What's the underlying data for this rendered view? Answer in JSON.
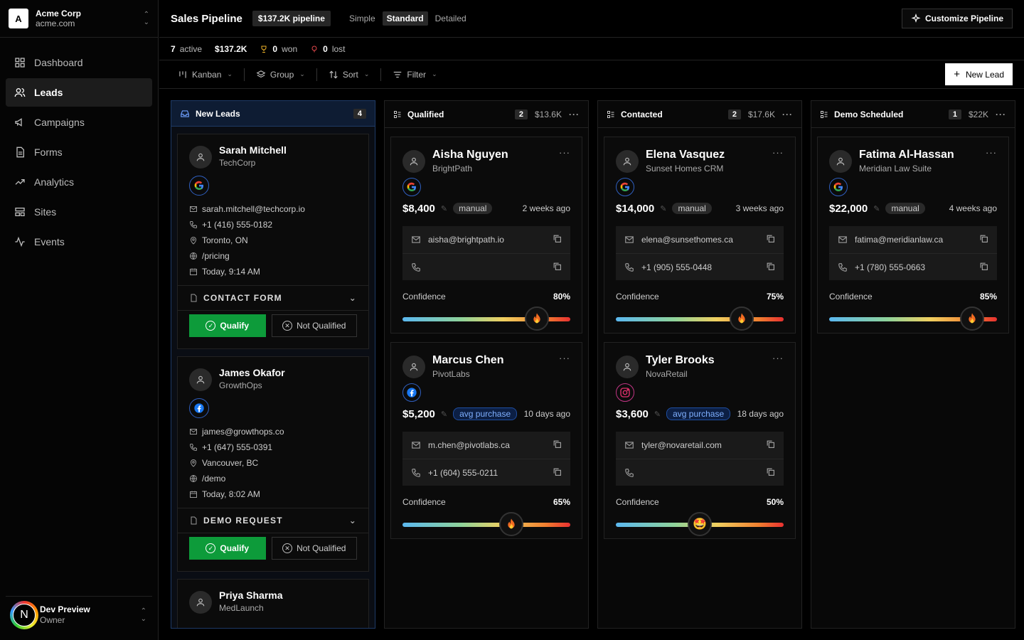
{
  "workspace": {
    "logo": "A",
    "name": "Acme Corp",
    "domain": "acme.com"
  },
  "nav": [
    {
      "label": "Dashboard",
      "icon": "dashboard-icon"
    },
    {
      "label": "Leads",
      "icon": "users-icon"
    },
    {
      "label": "Campaigns",
      "icon": "megaphone-icon"
    },
    {
      "label": "Forms",
      "icon": "document-icon"
    },
    {
      "label": "Analytics",
      "icon": "trending-up-icon"
    },
    {
      "label": "Sites",
      "icon": "layout-icon"
    },
    {
      "label": "Events",
      "icon": "activity-icon"
    }
  ],
  "active_nav": "Leads",
  "user": {
    "initial": "N",
    "name": "Dev Preview",
    "role": "Owner"
  },
  "header": {
    "title": "Sales Pipeline",
    "pipeline_value": "$137.2K pipeline",
    "views": [
      "Simple",
      "Standard",
      "Detailed"
    ],
    "active_view": "Standard",
    "customize_label": "Customize Pipeline"
  },
  "stats": {
    "active_count": "7",
    "active_label": "active",
    "total": "$137.2K",
    "won_count": "0",
    "won_label": "won",
    "lost_count": "0",
    "lost_label": "lost"
  },
  "toolbar": {
    "kanban": "Kanban",
    "group": "Group",
    "sort": "Sort",
    "filter": "Filter",
    "new_lead": "New Lead"
  },
  "new_leads": {
    "title": "New Leads",
    "count": "4",
    "cards": [
      {
        "name": "Sarah Mitchell",
        "company": "TechCorp",
        "source": "google",
        "email": "sarah.mitchell@techcorp.io",
        "phone": "+1 (416) 555-0182",
        "location": "Toronto, ON",
        "page": "/pricing",
        "time": "Today, 9:14 AM",
        "form": "CONTACT FORM"
      },
      {
        "name": "James Okafor",
        "company": "GrowthOps",
        "source": "facebook",
        "email": "james@growthops.co",
        "phone": "+1 (647) 555-0391",
        "location": "Vancouver, BC",
        "page": "/demo",
        "time": "Today, 8:02 AM",
        "form": "DEMO REQUEST"
      },
      {
        "name": "Priya Sharma",
        "company": "MedLaunch"
      }
    ],
    "qualify_label": "Qualify",
    "not_qualified_label": "Not Qualified"
  },
  "columns": [
    {
      "title": "Qualified",
      "count": "2",
      "value": "$13.6K",
      "cards": [
        {
          "name": "Aisha Nguyen",
          "company": "BrightPath",
          "source": "google",
          "value": "$8,400",
          "tag": "manual",
          "ago": "2 weeks ago",
          "email": "aisha@brightpath.io",
          "phone": "",
          "confidence": 80,
          "confidence_label": "80%"
        },
        {
          "name": "Marcus Chen",
          "company": "PivotLabs",
          "source": "facebook",
          "value": "$5,200",
          "tag": "avg purchase",
          "ago": "10 days ago",
          "email": "m.chen@pivotlabs.ca",
          "phone": "+1 (604) 555-0211",
          "confidence": 65,
          "confidence_label": "65%"
        }
      ]
    },
    {
      "title": "Contacted",
      "count": "2",
      "value": "$17.6K",
      "cards": [
        {
          "name": "Elena Vasquez",
          "company": "Sunset Homes CRM",
          "source": "google",
          "value": "$14,000",
          "tag": "manual",
          "ago": "3 weeks ago",
          "email": "elena@sunsethomes.ca",
          "phone": "+1 (905) 555-0448",
          "confidence": 75,
          "confidence_label": "75%"
        },
        {
          "name": "Tyler Brooks",
          "company": "NovaRetail",
          "source": "instagram",
          "value": "$3,600",
          "tag": "avg purchase",
          "ago": "18 days ago",
          "email": "tyler@novaretail.com",
          "phone": "",
          "confidence": 50,
          "confidence_label": "50%"
        }
      ]
    },
    {
      "title": "Demo Scheduled",
      "count": "1",
      "value": "$22K",
      "cards": [
        {
          "name": "Fatima Al-Hassan",
          "company": "Meridian Law Suite",
          "source": "google",
          "value": "$22,000",
          "tag": "manual",
          "ago": "4 weeks ago",
          "email": "fatima@meridianlaw.ca",
          "phone": "+1 (780) 555-0663",
          "confidence": 85,
          "confidence_label": "85%"
        }
      ]
    }
  ],
  "confidence_label": "Confidence",
  "colors": {
    "qualify_green": "#0d9b3a",
    "accent_blue": "#1e3a66",
    "google_blue": "#4285f4"
  }
}
